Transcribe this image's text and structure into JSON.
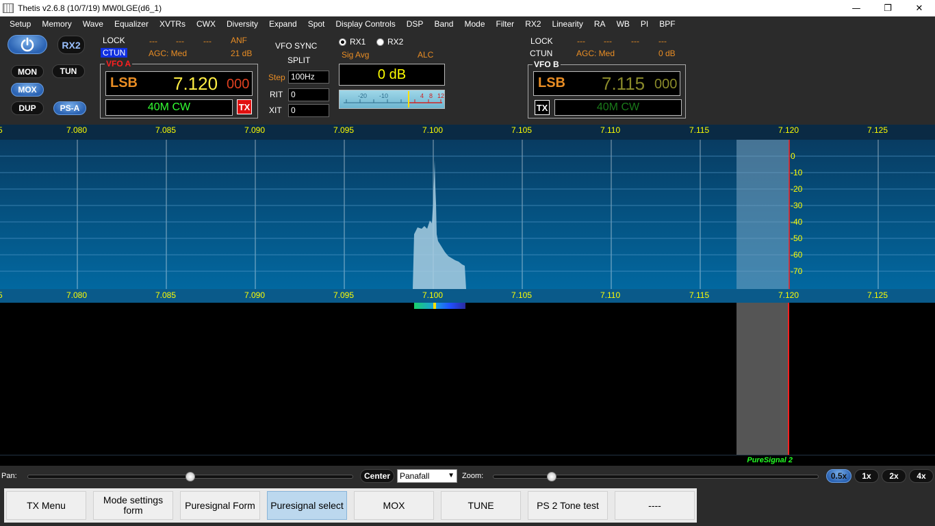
{
  "window": {
    "title": "Thetis v2.6.8 (10/7/19) MW0LGE(d6_1)",
    "minimize": "—",
    "maximize": "❐",
    "close": "✕"
  },
  "menu": [
    "Setup",
    "Memory",
    "Wave",
    "Equalizer",
    "XVTRs",
    "CWX",
    "Diversity",
    "Expand",
    "Spot",
    "Display Controls",
    "DSP",
    "Band",
    "Mode",
    "Filter",
    "RX2",
    "Linearity",
    "RA",
    "WB",
    "PI",
    "BPF"
  ],
  "buttons": {
    "rx2": "RX2",
    "mon": "MON",
    "tun": "TUN",
    "mox": "MOX",
    "dup": "DUP",
    "psa": "PS-A"
  },
  "vfo_a_status": {
    "lock": "LOCK",
    "ctun": "CTUN",
    "d1": "---",
    "d2": "---",
    "d3": "---",
    "anf": "ANF",
    "agc": "AGC: Med",
    "gain": "21 dB"
  },
  "vfo_a": {
    "title": "VFO A",
    "mode": "LSB",
    "freq_main": "7.120",
    "freq_sub": "000",
    "band": "40M CW",
    "tx": "TX"
  },
  "center": {
    "vfo_sync": "VFO SYNC",
    "split": "SPLIT",
    "step_label": "Step",
    "step_value": "100Hz",
    "rit_label": "RIT",
    "rit_value": "0",
    "xit_label": "XIT",
    "xit_value": "0"
  },
  "meter": {
    "rx1": "RX1",
    "rx2": "RX2",
    "mode": "Sig Avg",
    "alc": "ALC",
    "readout": "0 dB",
    "scale": [
      "-20",
      "-10",
      "4",
      "8",
      "12"
    ]
  },
  "vfo_b_status": {
    "lock": "LOCK",
    "ctun": "CTUN",
    "d1": "---",
    "d2": "---",
    "d3": "---",
    "d4": "---",
    "agc": "AGC: Med",
    "gain": "0 dB"
  },
  "vfo_b": {
    "title": "VFO B",
    "mode": "LSB",
    "freq_main": "7.115",
    "freq_sub": "000",
    "band": "40M CW",
    "tx": "TX"
  },
  "spectrum": {
    "freq_labels": [
      "7.080",
      "7.085",
      "7.090",
      "7.095",
      "7.100",
      "7.105",
      "7.110",
      "7.115",
      "7.120",
      "7.125"
    ],
    "db_labels": [
      "0",
      "-10",
      "-20",
      "-30",
      "-40",
      "-50",
      "-60",
      "-70"
    ],
    "colors": {
      "bg_top": "#0a4a7a",
      "bg_bottom": "#02649a",
      "axis_label": "#ffff00",
      "tx_line": "#ff2020"
    }
  },
  "status": {
    "pure_signal": "PureSignal 2"
  },
  "bottom": {
    "pan_label": "Pan:",
    "center_btn": "Center",
    "display_mode": "Panafall",
    "zoom_label": "Zoom:",
    "zoom_btns": [
      "0.5x",
      "1x",
      "2x",
      "4x"
    ],
    "pan_value": 0.5,
    "zoom_value": 0.18
  },
  "fkeys": [
    "TX Menu",
    "Mode settings form",
    "Puresignal Form",
    "Puresignal select",
    "MOX",
    "TUNE",
    "PS 2 Tone test",
    "----"
  ]
}
